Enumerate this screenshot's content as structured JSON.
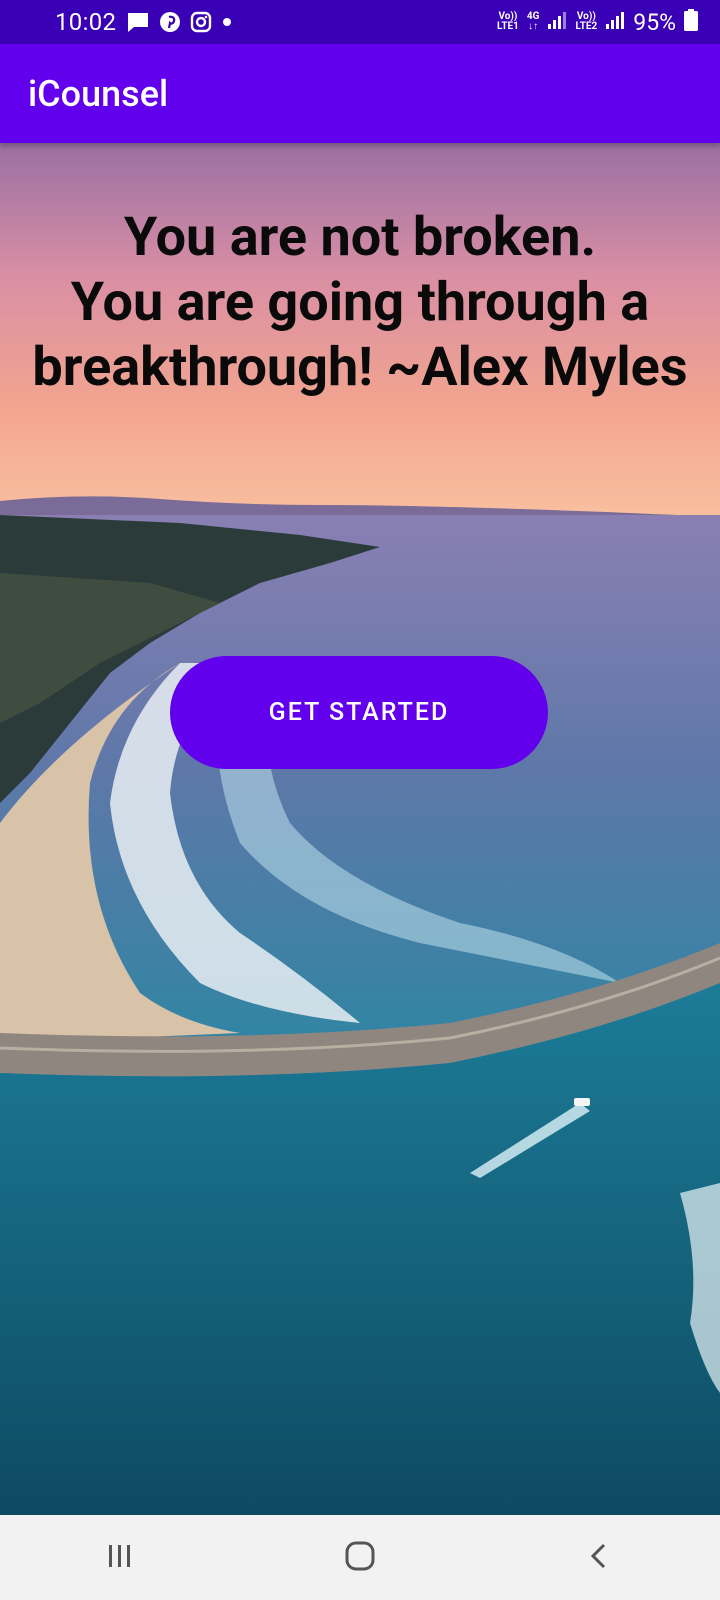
{
  "status_bar": {
    "time": "10:02",
    "left_icons": [
      "message-icon",
      "pinterest-icon",
      "instagram-icon",
      "dot-icon"
    ],
    "sim1": "LTE1",
    "sim1_top": "Vo))",
    "network": "4G",
    "sim2": "LTE2",
    "sim2_top": "Vo))",
    "battery": "95%"
  },
  "app_bar": {
    "title": "iCounsel"
  },
  "quote": {
    "lines": [
      "You are not broken.",
      "You are going through a",
      "breakthrough! ~Alex Myles"
    ]
  },
  "cta": {
    "label": "GET STARTED"
  },
  "nav_bar": {
    "buttons": [
      "recents-icon",
      "home-icon",
      "back-icon"
    ]
  },
  "colors": {
    "primary": "#6200ee",
    "status_bar": "#3a00b5",
    "nav_bar": "#f2f2f2"
  }
}
